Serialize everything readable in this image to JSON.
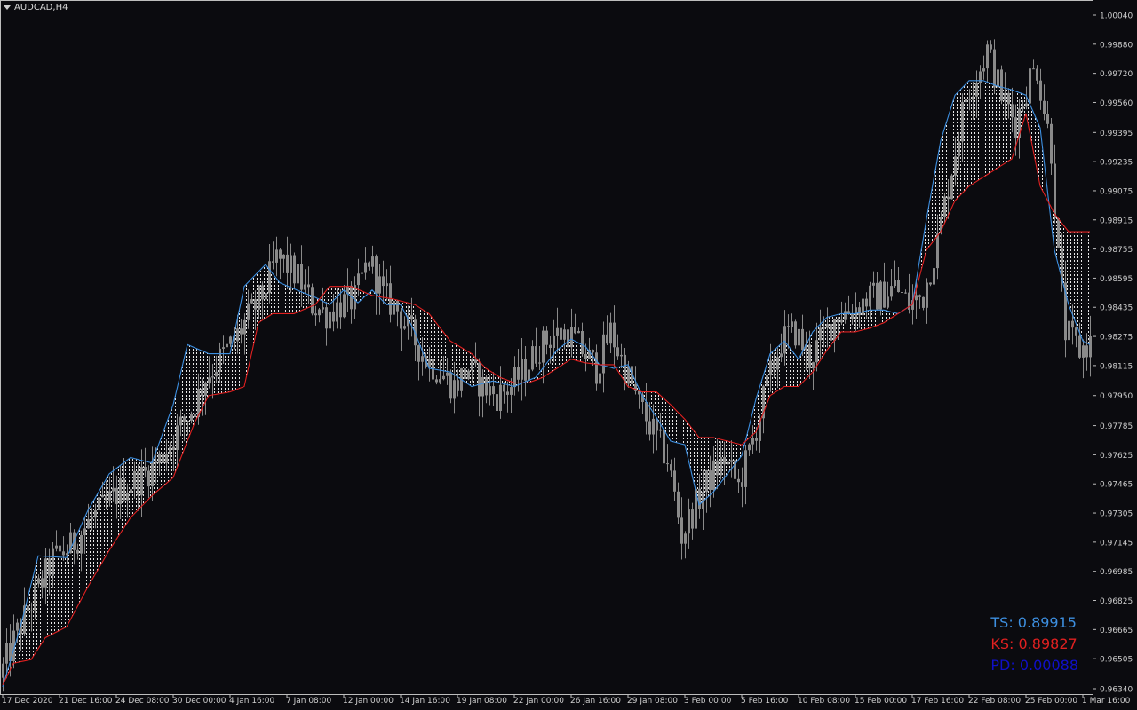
{
  "chart_title": "AUDCAD,H4",
  "colors": {
    "background": "#0b0b0f",
    "candle": "#8a8a8a",
    "tenkan": "#3d8fe0",
    "kijun": "#e02020",
    "cloud_fill": "#ffffff",
    "axis_text": "#cfcfcf",
    "pd_text": "#1010c8"
  },
  "info": {
    "ts": "TS: 0.89915",
    "ks": "KS: 0.89827",
    "pd": "PD: 0.00088"
  },
  "chart_data": {
    "type": "candlestick",
    "symbol": "AUDCAD",
    "timeframe": "H4",
    "ylim": [
      0.9634,
      1.0004
    ],
    "y_ticks": [
      "1.00040",
      "0.99880",
      "0.99720",
      "0.99560",
      "0.99395",
      "0.99235",
      "0.99075",
      "0.98915",
      "0.98755",
      "0.98595",
      "0.98435",
      "0.98275",
      "0.98115",
      "0.97950",
      "0.97785",
      "0.97625",
      "0.97465",
      "0.97305",
      "0.97145",
      "0.96985",
      "0.96825",
      "0.96665",
      "0.96505",
      "0.96340"
    ],
    "x_labels": [
      "17 Dec 2020",
      "21 Dec 16:00",
      "24 Dec 08:00",
      "30 Dec 00:00",
      "4 Jan 16:00",
      "7 Jan 08:00",
      "12 Jan 00:00",
      "14 Jan 16:00",
      "19 Jan 08:00",
      "22 Jan 00:00",
      "26 Jan 16:00",
      "29 Jan 08:00",
      "3 Feb 00:00",
      "5 Feb 16:00",
      "10 Feb 08:00",
      "15 Feb 00:00",
      "17 Feb 16:00",
      "22 Feb 08:00",
      "25 Feb 00:00",
      "1 Mar 16:00"
    ],
    "x_label_bar_index": [
      0,
      16,
      32,
      48,
      64,
      80,
      96,
      112,
      128,
      144,
      160,
      176,
      192,
      208,
      224,
      240,
      256,
      272,
      288,
      304
    ],
    "bar_count": 309,
    "price_path": [
      [
        0,
        0.964
      ],
      [
        5,
        0.9665
      ],
      [
        10,
        0.9685
      ],
      [
        15,
        0.9705
      ],
      [
        20,
        0.9712
      ],
      [
        25,
        0.9725
      ],
      [
        30,
        0.9735
      ],
      [
        35,
        0.9745
      ],
      [
        40,
        0.975
      ],
      [
        45,
        0.976
      ],
      [
        50,
        0.9775
      ],
      [
        55,
        0.979
      ],
      [
        58,
        0.9805
      ],
      [
        62,
        0.9815
      ],
      [
        66,
        0.9825
      ],
      [
        70,
        0.9838
      ],
      [
        74,
        0.985
      ],
      [
        78,
        0.987
      ],
      [
        80,
        0.9868
      ],
      [
        84,
        0.986
      ],
      [
        88,
        0.9845
      ],
      [
        92,
        0.984
      ],
      [
        96,
        0.9845
      ],
      [
        100,
        0.9848
      ],
      [
        104,
        0.987
      ],
      [
        108,
        0.985
      ],
      [
        112,
        0.9842
      ],
      [
        116,
        0.9828
      ],
      [
        120,
        0.9815
      ],
      [
        124,
        0.9808
      ],
      [
        128,
        0.98
      ],
      [
        132,
        0.981
      ],
      [
        136,
        0.98
      ],
      [
        140,
        0.9795
      ],
      [
        144,
        0.98
      ],
      [
        148,
        0.981
      ],
      [
        152,
        0.9822
      ],
      [
        156,
        0.9828
      ],
      [
        160,
        0.983
      ],
      [
        164,
        0.982
      ],
      [
        168,
        0.981
      ],
      [
        172,
        0.983
      ],
      [
        176,
        0.981
      ],
      [
        180,
        0.979
      ],
      [
        184,
        0.9775
      ],
      [
        188,
        0.976
      ],
      [
        190,
        0.974
      ],
      [
        192,
        0.9718
      ],
      [
        196,
        0.9735
      ],
      [
        200,
        0.975
      ],
      [
        204,
        0.976
      ],
      [
        208,
        0.9745
      ],
      [
        212,
        0.977
      ],
      [
        216,
        0.98
      ],
      [
        220,
        0.9825
      ],
      [
        224,
        0.983
      ],
      [
        228,
        0.9815
      ],
      [
        232,
        0.9828
      ],
      [
        236,
        0.984
      ],
      [
        240,
        0.9842
      ],
      [
        244,
        0.9848
      ],
      [
        248,
        0.985
      ],
      [
        252,
        0.9855
      ],
      [
        256,
        0.9845
      ],
      [
        260,
        0.985
      ],
      [
        264,
        0.988
      ],
      [
        268,
        0.992
      ],
      [
        272,
        0.996
      ],
      [
        276,
        0.9975
      ],
      [
        278,
        0.9985
      ],
      [
        282,
        0.996
      ],
      [
        286,
        0.9945
      ],
      [
        290,
        0.997
      ],
      [
        292,
        0.9975
      ],
      [
        296,
        0.993
      ],
      [
        298,
        0.987
      ],
      [
        300,
        0.983
      ],
      [
        304,
        0.982
      ],
      [
        308,
        0.9825
      ]
    ],
    "indicators": [
      {
        "name": "Tenkan-sen",
        "color": "#3d8fe0",
        "path": [
          [
            0,
            0.9635
          ],
          [
            5,
            0.9668
          ],
          [
            10,
            0.9707
          ],
          [
            18,
            0.9706
          ],
          [
            24,
            0.9732
          ],
          [
            30,
            0.9752
          ],
          [
            36,
            0.9761
          ],
          [
            42,
            0.9758
          ],
          [
            48,
            0.979
          ],
          [
            52,
            0.9823
          ],
          [
            58,
            0.9818
          ],
          [
            64,
            0.9818
          ],
          [
            68,
            0.9855
          ],
          [
            74,
            0.9867
          ],
          [
            78,
            0.9857
          ],
          [
            84,
            0.9852
          ],
          [
            88,
            0.9849
          ],
          [
            92,
            0.9845
          ],
          [
            96,
            0.9853
          ],
          [
            100,
            0.9846
          ],
          [
            104,
            0.9853
          ],
          [
            108,
            0.9845
          ],
          [
            112,
            0.9845
          ],
          [
            116,
            0.983
          ],
          [
            120,
            0.981
          ],
          [
            126,
            0.9808
          ],
          [
            132,
            0.98
          ],
          [
            138,
            0.9803
          ],
          [
            144,
            0.98
          ],
          [
            150,
            0.9805
          ],
          [
            156,
            0.982
          ],
          [
            160,
            0.9826
          ],
          [
            164,
            0.9822
          ],
          [
            168,
            0.9812
          ],
          [
            172,
            0.981
          ],
          [
            176,
            0.9812
          ],
          [
            180,
            0.9795
          ],
          [
            184,
            0.9783
          ],
          [
            188,
            0.977
          ],
          [
            192,
            0.9768
          ],
          [
            196,
            0.9735
          ],
          [
            200,
            0.9742
          ],
          [
            204,
            0.9752
          ],
          [
            208,
            0.9762
          ],
          [
            212,
            0.9793
          ],
          [
            216,
            0.9818
          ],
          [
            220,
            0.9825
          ],
          [
            224,
            0.9815
          ],
          [
            228,
            0.983
          ],
          [
            232,
            0.9838
          ],
          [
            236,
            0.984
          ],
          [
            240,
            0.984
          ],
          [
            244,
            0.9842
          ],
          [
            248,
            0.9842
          ],
          [
            252,
            0.984
          ],
          [
            256,
            0.9845
          ],
          [
            260,
            0.9892
          ],
          [
            264,
            0.9935
          ],
          [
            268,
            0.996
          ],
          [
            272,
            0.9968
          ],
          [
            276,
            0.9968
          ],
          [
            280,
            0.9965
          ],
          [
            284,
            0.9963
          ],
          [
            288,
            0.996
          ],
          [
            292,
            0.9942
          ],
          [
            296,
            0.9875
          ],
          [
            300,
            0.9845
          ],
          [
            304,
            0.9825
          ],
          [
            306,
            0.9823
          ]
        ]
      },
      {
        "name": "Kijun-sen",
        "color": "#e02020",
        "path": [
          [
            0,
            0.9636
          ],
          [
            3,
            0.9648
          ],
          [
            8,
            0.965
          ],
          [
            12,
            0.9662
          ],
          [
            18,
            0.9668
          ],
          [
            24,
            0.969
          ],
          [
            30,
            0.971
          ],
          [
            36,
            0.9728
          ],
          [
            42,
            0.974
          ],
          [
            48,
            0.975
          ],
          [
            54,
            0.978
          ],
          [
            58,
            0.9795
          ],
          [
            64,
            0.9797
          ],
          [
            68,
            0.98
          ],
          [
            72,
            0.9835
          ],
          [
            76,
            0.984
          ],
          [
            82,
            0.984
          ],
          [
            88,
            0.9845
          ],
          [
            92,
            0.9855
          ],
          [
            98,
            0.9855
          ],
          [
            104,
            0.985
          ],
          [
            110,
            0.9848
          ],
          [
            116,
            0.9845
          ],
          [
            120,
            0.984
          ],
          [
            126,
            0.9825
          ],
          [
            132,
            0.9818
          ],
          [
            136,
            0.981
          ],
          [
            140,
            0.9805
          ],
          [
            144,
            0.9802
          ],
          [
            148,
            0.9802
          ],
          [
            152,
            0.9805
          ],
          [
            156,
            0.981
          ],
          [
            160,
            0.9815
          ],
          [
            164,
            0.9813
          ],
          [
            168,
            0.9812
          ],
          [
            172,
            0.9812
          ],
          [
            176,
            0.98
          ],
          [
            180,
            0.9797
          ],
          [
            184,
            0.9797
          ],
          [
            188,
            0.979
          ],
          [
            192,
            0.9782
          ],
          [
            196,
            0.9772
          ],
          [
            200,
            0.9772
          ],
          [
            204,
            0.977
          ],
          [
            208,
            0.9768
          ],
          [
            212,
            0.9775
          ],
          [
            216,
            0.9795
          ],
          [
            220,
            0.98
          ],
          [
            224,
            0.98
          ],
          [
            228,
            0.9808
          ],
          [
            232,
            0.982
          ],
          [
            236,
            0.983
          ],
          [
            240,
            0.983
          ],
          [
            244,
            0.9832
          ],
          [
            248,
            0.9835
          ],
          [
            252,
            0.984
          ],
          [
            256,
            0.9845
          ],
          [
            260,
            0.9875
          ],
          [
            264,
            0.9885
          ],
          [
            268,
            0.9902
          ],
          [
            272,
            0.991
          ],
          [
            276,
            0.9915
          ],
          [
            280,
            0.992
          ],
          [
            284,
            0.9925
          ],
          [
            288,
            0.995
          ],
          [
            292,
            0.991
          ],
          [
            296,
            0.9895
          ],
          [
            300,
            0.9885
          ],
          [
            304,
            0.9885
          ],
          [
            306,
            0.9885
          ]
        ]
      }
    ],
    "cloud": "dotted fill between Tenkan-sen and Kijun-sen",
    "grid": false
  }
}
